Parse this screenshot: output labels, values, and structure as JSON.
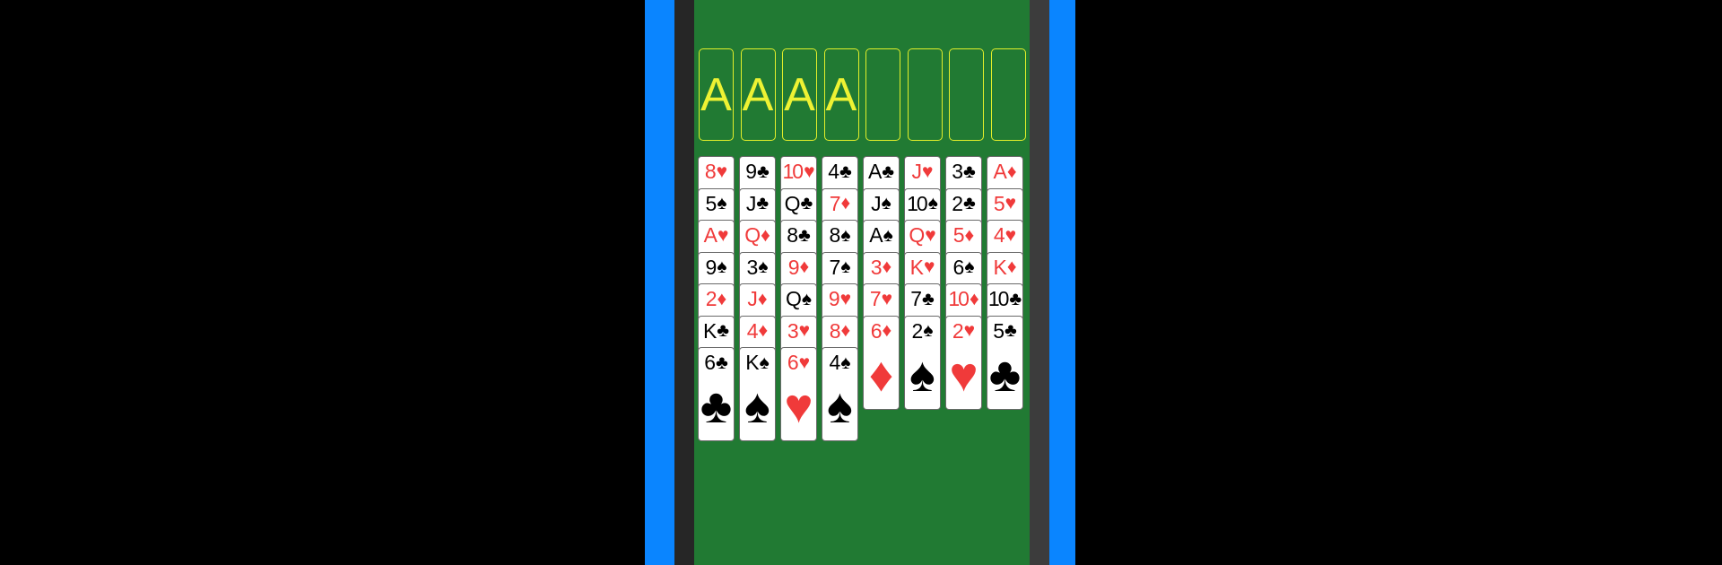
{
  "foundations": [
    {
      "label": "A"
    },
    {
      "label": "A"
    },
    {
      "label": "A"
    },
    {
      "label": "A"
    }
  ],
  "freecells": [
    {
      "label": ""
    },
    {
      "label": ""
    },
    {
      "label": ""
    },
    {
      "label": ""
    }
  ],
  "tableau": [
    [
      {
        "rank": "8",
        "suit": "heart"
      },
      {
        "rank": "5",
        "suit": "spade"
      },
      {
        "rank": "A",
        "suit": "heart"
      },
      {
        "rank": "9",
        "suit": "spade"
      },
      {
        "rank": "2",
        "suit": "diamond"
      },
      {
        "rank": "K",
        "suit": "club"
      },
      {
        "rank": "6",
        "suit": "club"
      }
    ],
    [
      {
        "rank": "9",
        "suit": "club"
      },
      {
        "rank": "J",
        "suit": "club"
      },
      {
        "rank": "Q",
        "suit": "diamond"
      },
      {
        "rank": "3",
        "suit": "spade"
      },
      {
        "rank": "J",
        "suit": "diamond"
      },
      {
        "rank": "4",
        "suit": "diamond"
      },
      {
        "rank": "K",
        "suit": "spade"
      }
    ],
    [
      {
        "rank": "10",
        "suit": "heart"
      },
      {
        "rank": "Q",
        "suit": "club"
      },
      {
        "rank": "8",
        "suit": "club"
      },
      {
        "rank": "9",
        "suit": "diamond"
      },
      {
        "rank": "Q",
        "suit": "spade"
      },
      {
        "rank": "3",
        "suit": "heart"
      },
      {
        "rank": "6",
        "suit": "heart"
      }
    ],
    [
      {
        "rank": "4",
        "suit": "club"
      },
      {
        "rank": "7",
        "suit": "diamond"
      },
      {
        "rank": "8",
        "suit": "spade"
      },
      {
        "rank": "7",
        "suit": "spade"
      },
      {
        "rank": "9",
        "suit": "heart"
      },
      {
        "rank": "8",
        "suit": "diamond"
      },
      {
        "rank": "4",
        "suit": "spade"
      }
    ],
    [
      {
        "rank": "A",
        "suit": "club"
      },
      {
        "rank": "J",
        "suit": "spade"
      },
      {
        "rank": "A",
        "suit": "spade"
      },
      {
        "rank": "3",
        "suit": "diamond"
      },
      {
        "rank": "7",
        "suit": "heart"
      },
      {
        "rank": "6",
        "suit": "diamond"
      }
    ],
    [
      {
        "rank": "J",
        "suit": "heart"
      },
      {
        "rank": "10",
        "suit": "spade"
      },
      {
        "rank": "Q",
        "suit": "heart"
      },
      {
        "rank": "K",
        "suit": "heart"
      },
      {
        "rank": "7",
        "suit": "club"
      },
      {
        "rank": "2",
        "suit": "spade"
      }
    ],
    [
      {
        "rank": "3",
        "suit": "club"
      },
      {
        "rank": "2",
        "suit": "club"
      },
      {
        "rank": "5",
        "suit": "diamond"
      },
      {
        "rank": "6",
        "suit": "spade"
      },
      {
        "rank": "10",
        "suit": "diamond"
      },
      {
        "rank": "2",
        "suit": "heart"
      }
    ],
    [
      {
        "rank": "A",
        "suit": "diamond"
      },
      {
        "rank": "5",
        "suit": "heart"
      },
      {
        "rank": "4",
        "suit": "heart"
      },
      {
        "rank": "K",
        "suit": "diamond"
      },
      {
        "rank": "10",
        "suit": "club"
      },
      {
        "rank": "5",
        "suit": "club"
      }
    ]
  ],
  "colors": {
    "felt": "#217a33",
    "slot_outline": "#e3ef2a",
    "red_suit": "#f03a3a",
    "black_suit": "#000000",
    "device_frame": "#0a85ff"
  }
}
